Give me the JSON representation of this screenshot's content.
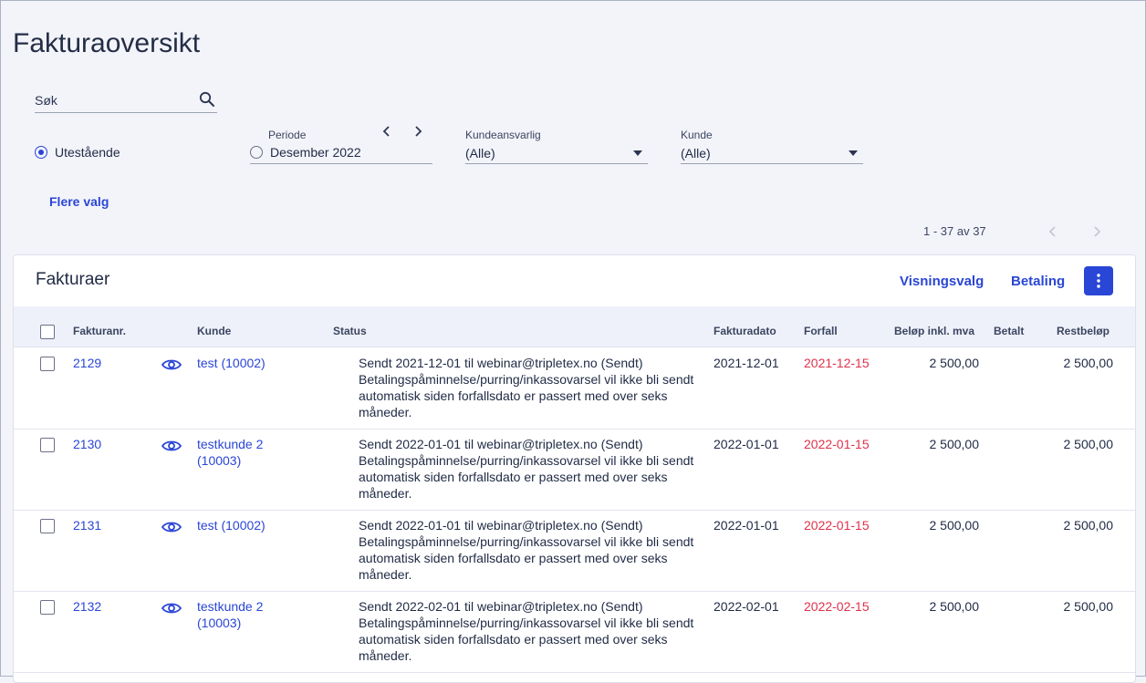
{
  "page": {
    "title": "Fakturaoversikt"
  },
  "filters": {
    "search_placeholder": "Søk",
    "outstanding_label": "Utestående",
    "period_label": "Periode",
    "period_value": "Desember 2022",
    "prev_icon": "chevron-left-icon",
    "next_icon": "chevron-right-icon",
    "account_manager_label": "Kundeansvarlig",
    "account_manager_value": "(Alle)",
    "customer_label": "Kunde",
    "customer_value": "(Alle)",
    "more_options": "Flere valg"
  },
  "pager": {
    "text": "1 - 37 av 37"
  },
  "panel": {
    "title": "Fakturaer",
    "view_options": "Visningsvalg",
    "payment": "Betaling"
  },
  "columns": {
    "number": "Fakturanr.",
    "customer": "Kunde",
    "status": "Status",
    "invoice_date": "Fakturadato",
    "due": "Forfall",
    "amount": "Beløp inkl. mva",
    "paid": "Betalt",
    "remaining": "Restbeløp"
  },
  "colors": {
    "accent": "#2a46d6",
    "overdue": "#e0314b"
  },
  "invoices": [
    {
      "number": "2129",
      "customer": "test (10002)",
      "status_line1": "Sendt 2021-12-01 til webinar@tripletex.no (Sendt)",
      "status_line2": "Betalingspåminnelse/purring/inkassovarsel vil ikke bli sendt automatisk siden forfallsdato er passert med over seks måneder.",
      "invoice_date": "2021-12-01",
      "due": "2021-12-15",
      "amount": "2 500,00",
      "paid": "",
      "remaining": "2 500,00"
    },
    {
      "number": "2130",
      "customer": "testkunde 2 (10003)",
      "status_line1": "Sendt 2022-01-01 til webinar@tripletex.no (Sendt)",
      "status_line2": "Betalingspåminnelse/purring/inkassovarsel vil ikke bli sendt automatisk siden forfallsdato er passert med over seks måneder.",
      "invoice_date": "2022-01-01",
      "due": "2022-01-15",
      "amount": "2 500,00",
      "paid": "",
      "remaining": "2 500,00"
    },
    {
      "number": "2131",
      "customer": "test (10002)",
      "status_line1": "Sendt 2022-01-01 til webinar@tripletex.no (Sendt)",
      "status_line2": "Betalingspåminnelse/purring/inkassovarsel vil ikke bli sendt automatisk siden forfallsdato er passert med over seks måneder.",
      "invoice_date": "2022-01-01",
      "due": "2022-01-15",
      "amount": "2 500,00",
      "paid": "",
      "remaining": "2 500,00"
    },
    {
      "number": "2132",
      "customer": "testkunde 2 (10003)",
      "status_line1": "Sendt 2022-02-01 til webinar@tripletex.no (Sendt)",
      "status_line2": "Betalingspåminnelse/purring/inkassovarsel vil ikke bli sendt automatisk siden forfallsdato er passert med over seks måneder.",
      "invoice_date": "2022-02-01",
      "due": "2022-02-15",
      "amount": "2 500,00",
      "paid": "",
      "remaining": "2 500,00"
    }
  ]
}
